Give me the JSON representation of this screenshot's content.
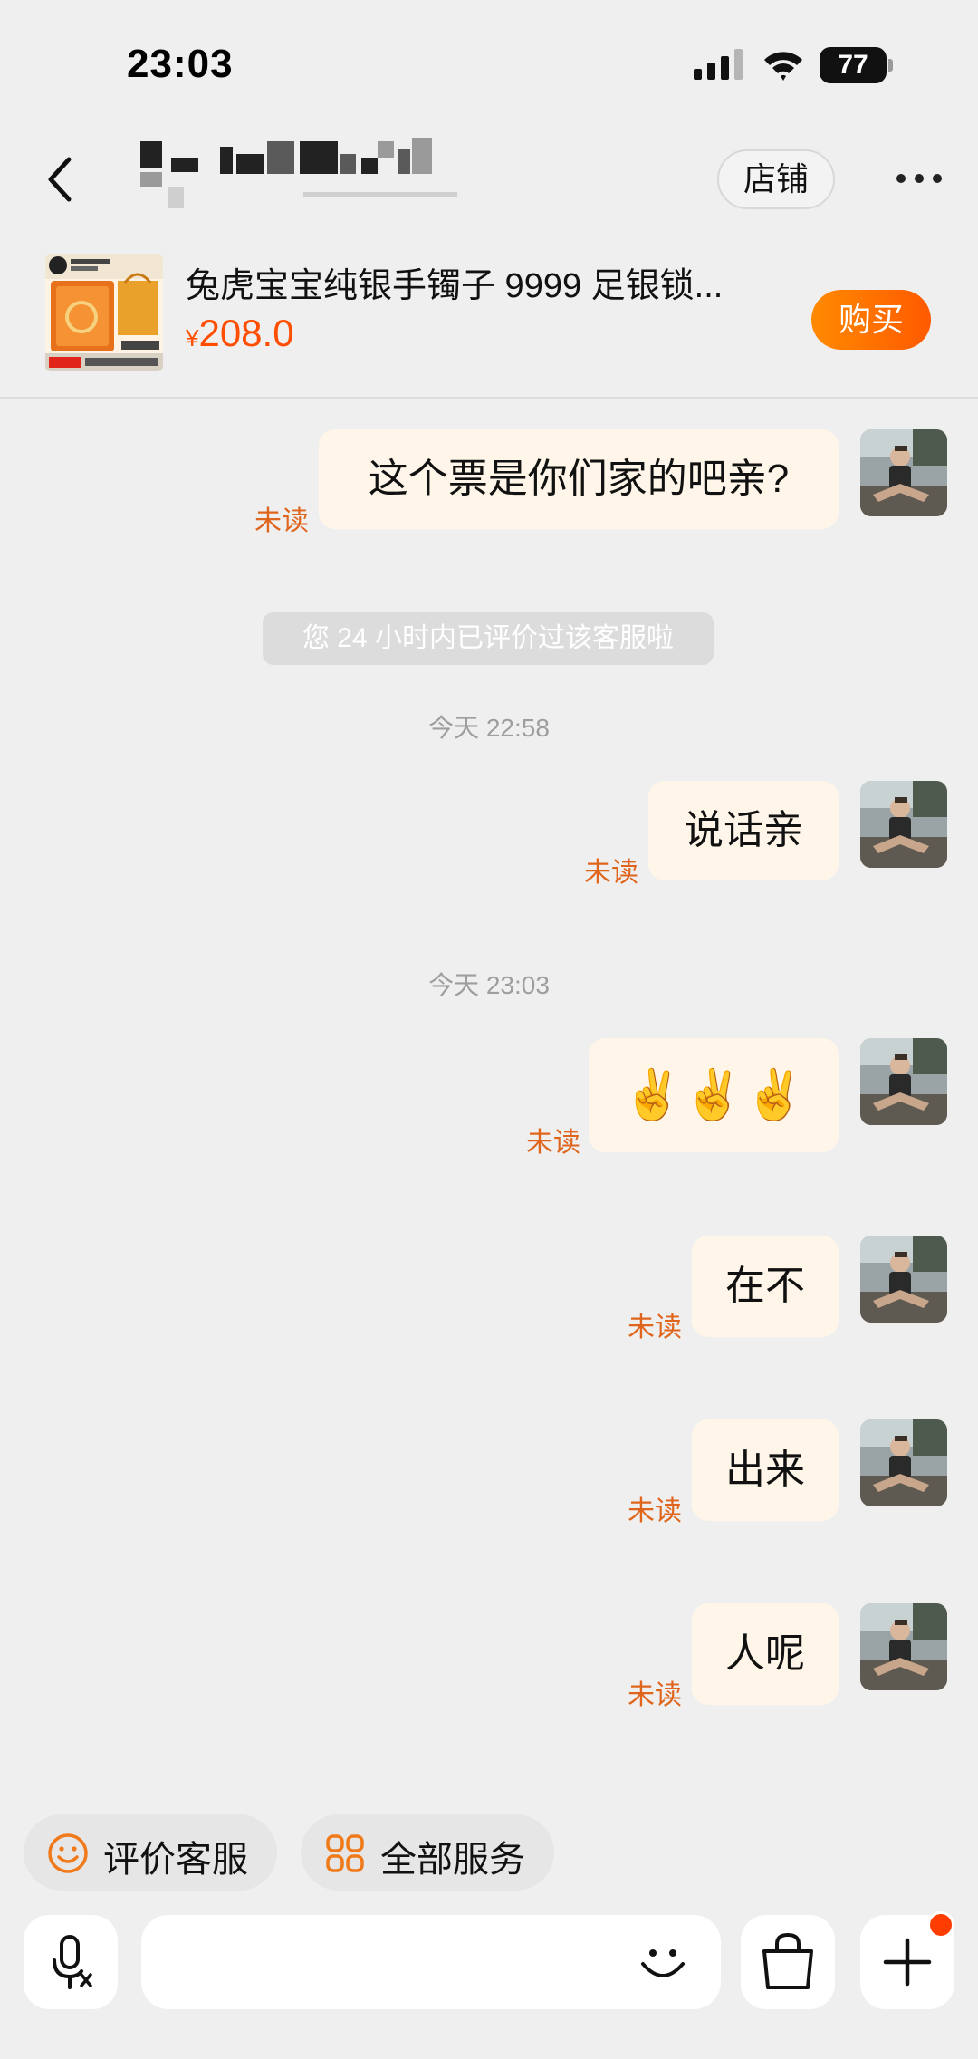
{
  "status_bar": {
    "time": "23:03",
    "battery": "77"
  },
  "header": {
    "store_button": "店铺"
  },
  "product": {
    "title": "兔虎宝宝纯银手镯子 9999 足银锁...",
    "currency": "¥",
    "price": "208.0",
    "buy_button": "购买"
  },
  "chat": {
    "messages": [
      {
        "text": "这个票是你们家的吧亲?",
        "status": "未读"
      },
      {
        "text": "说话亲",
        "status": "未读"
      },
      {
        "text": "✌️✌️✌️",
        "status": "未读"
      },
      {
        "text": "在不",
        "status": "未读"
      },
      {
        "text": "出来",
        "status": "未读"
      },
      {
        "text": "人呢",
        "status": "未读"
      }
    ],
    "system_notice": "您 24 小时内已评价过该客服啦",
    "timestamps": [
      "今天 22:58",
      "今天 23:03"
    ]
  },
  "quick_actions": [
    {
      "label": "评价客服",
      "icon": "smile-icon"
    },
    {
      "label": "全部服务",
      "icon": "grid-icon"
    }
  ],
  "input_bar": {
    "voice_icon": "voice-input-icon",
    "emoji_icon": "emoji-icon",
    "bag_icon": "shopping-bag-icon",
    "plus_icon": "plus-icon"
  },
  "colors": {
    "accent": "#ff6a00",
    "unread": "#e0651c",
    "bubble": "#fff6e9",
    "background": "#efefef"
  }
}
